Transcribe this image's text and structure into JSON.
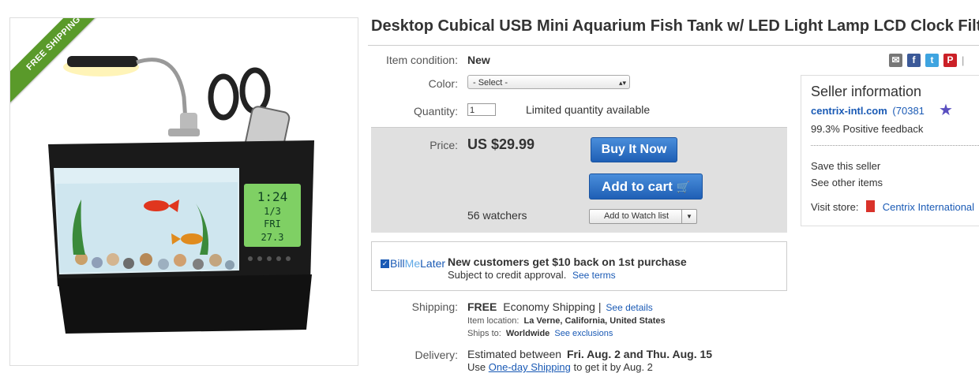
{
  "banner": {
    "ribbon_text": "FREE SHIPPING"
  },
  "product": {
    "title": "Desktop Cubical USB Mini Aquarium Fish Tank w/ LED Light Lamp LCD Clock Filter"
  },
  "clock_display": {
    "time": "1:24",
    "date": "1/3",
    "day": "FRI",
    "temp": "27.3"
  },
  "details": {
    "condition_label": "Item condition:",
    "condition_value": "New",
    "color_label": "Color:",
    "color_value": "- Select -",
    "quantity_label": "Quantity:",
    "quantity_value": "1",
    "quantity_note": "Limited quantity available"
  },
  "price": {
    "label": "Price:",
    "value": "US $29.99",
    "buy_now": "Buy It Now",
    "add_to_cart": "Add to cart",
    "watchers": "56 watchers",
    "watch_list": "Add to Watch list"
  },
  "bml": {
    "logo_bill": "Bill",
    "logo_me": "Me",
    "logo_later": "Later",
    "headline": "New customers get $10 back on 1st purchase",
    "subtext": "Subject to credit approval.",
    "terms_link": "See terms"
  },
  "shipping": {
    "label": "Shipping:",
    "free": "FREE",
    "method": "Economy Shipping |",
    "details_link": "See details",
    "location_label": "Item location:",
    "location_value": "La Verne, California, United States",
    "ships_label": "Ships to:",
    "ships_value": "Worldwide",
    "exclusions_link": "See exclusions"
  },
  "delivery": {
    "label": "Delivery:",
    "text_prefix": "Estimated between",
    "dates": "Fri. Aug. 2 and Thu. Aug. 15",
    "line2_prefix": "Use",
    "line2_link": "One-day Shipping",
    "line2_suffix": "to get it by Aug. 2"
  },
  "share": {
    "separator": "|"
  },
  "seller": {
    "heading": "Seller information",
    "name": "centrix-intl.com",
    "score": "(70381",
    "feedback": "99.3% Positive feedback",
    "save_link": "Save this seller",
    "other_link": "See other items",
    "store_label": "Visit store:",
    "store_name": "Centrix International"
  },
  "colors": {
    "accent_blue": "#1f5fb5",
    "ribbon_green": "#5a9a2a",
    "link": "#1a5ab5"
  }
}
